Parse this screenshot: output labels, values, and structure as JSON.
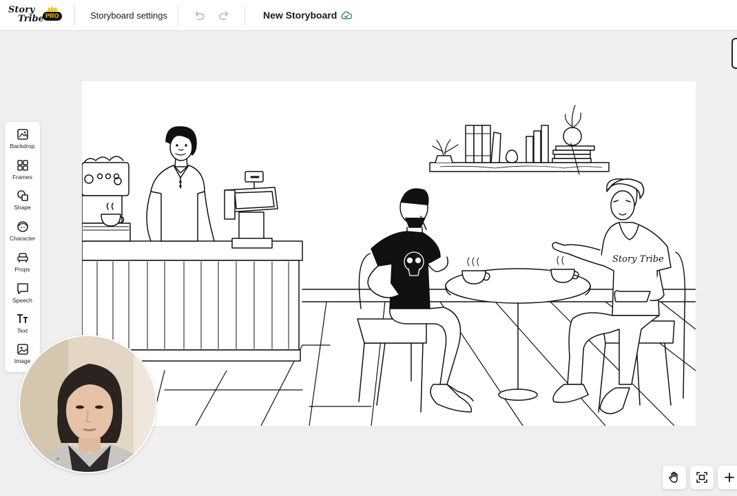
{
  "header": {
    "logo_line1": "Story",
    "logo_line2": "Tribe",
    "pro_badge": "PRO",
    "settings_label": "Storyboard settings",
    "document_title": "New Storyboard"
  },
  "toolbar": {
    "items": [
      {
        "label": "Backdrop",
        "icon": "backdrop-icon"
      },
      {
        "label": "Frames",
        "icon": "frames-icon"
      },
      {
        "label": "Shape",
        "icon": "shape-icon"
      },
      {
        "label": "Character",
        "icon": "character-icon"
      },
      {
        "label": "Props",
        "icon": "props-icon"
      },
      {
        "label": "Speech",
        "icon": "speech-icon"
      },
      {
        "label": "Text",
        "icon": "text-icon"
      },
      {
        "label": "Image",
        "icon": "image-icon"
      }
    ]
  },
  "canvas": {
    "scene": "cafe illustration",
    "hoodie_text": "Story Tribe"
  },
  "controls": {
    "icons": [
      "hand-pan-icon",
      "fit-screen-icon",
      "zoom-in-icon"
    ]
  },
  "colors": {
    "pro_gold": "#f5c51a",
    "saved_green": "#2e8b57",
    "background": "#efefef"
  }
}
